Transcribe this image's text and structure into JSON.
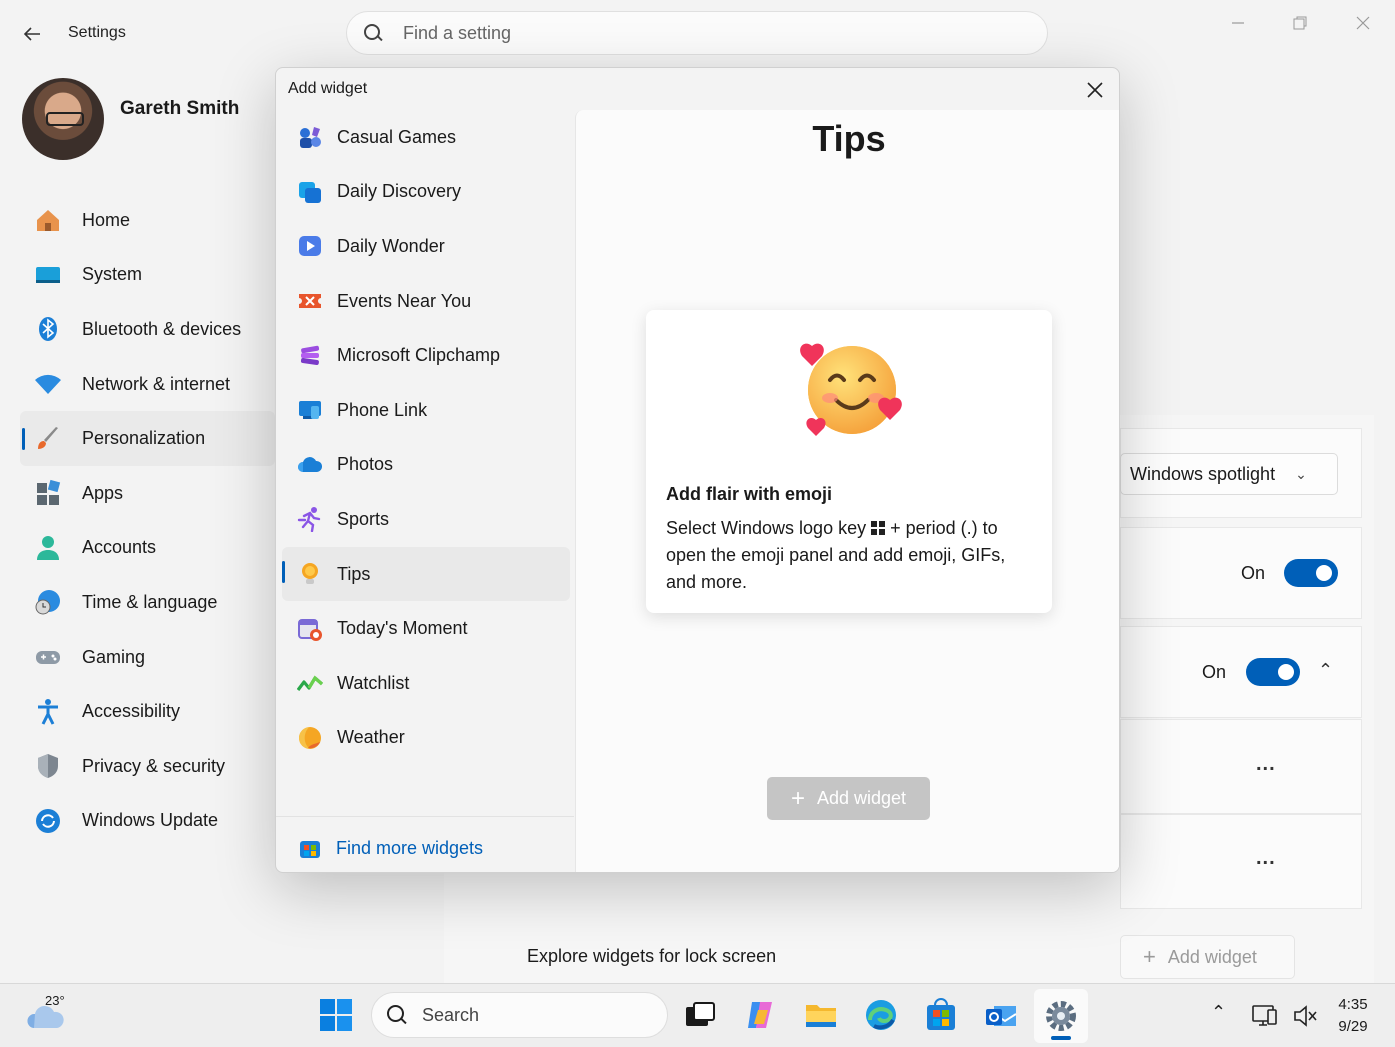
{
  "window": {
    "app_title": "Settings",
    "search_placeholder": "Find a setting"
  },
  "profile": {
    "name": "Gareth Smith"
  },
  "sidebar": {
    "items": [
      {
        "label": "Home",
        "icon": "home-icon"
      },
      {
        "label": "System",
        "icon": "system-icon"
      },
      {
        "label": "Bluetooth & devices",
        "icon": "bluetooth-icon"
      },
      {
        "label": "Network & internet",
        "icon": "wifi-icon"
      },
      {
        "label": "Personalization",
        "icon": "paintbrush-icon",
        "active": true
      },
      {
        "label": "Apps",
        "icon": "apps-icon"
      },
      {
        "label": "Accounts",
        "icon": "person-icon"
      },
      {
        "label": "Time & language",
        "icon": "globe-clock-icon"
      },
      {
        "label": "Gaming",
        "icon": "gamepad-icon"
      },
      {
        "label": "Accessibility",
        "icon": "accessibility-icon"
      },
      {
        "label": "Privacy & security",
        "icon": "shield-icon"
      },
      {
        "label": "Windows Update",
        "icon": "update-icon"
      }
    ]
  },
  "background": {
    "dropdown_value": "Windows spotlight",
    "toggle1_label": "On",
    "toggle2_label": "On",
    "more1": "...",
    "more2": "...",
    "explore_label": "Explore widgets for lock screen",
    "add_widget_label": "Add widget"
  },
  "dialog": {
    "title": "Add widget",
    "widgets": [
      {
        "label": "Casual Games",
        "icon": "casual-games-icon"
      },
      {
        "label": "Daily Discovery",
        "icon": "daily-discovery-icon"
      },
      {
        "label": "Daily Wonder",
        "icon": "daily-wonder-icon"
      },
      {
        "label": "Events Near You",
        "icon": "events-icon"
      },
      {
        "label": "Microsoft Clipchamp",
        "icon": "clipchamp-icon"
      },
      {
        "label": "Phone Link",
        "icon": "phone-link-icon"
      },
      {
        "label": "Photos",
        "icon": "photos-icon"
      },
      {
        "label": "Sports",
        "icon": "sports-icon"
      },
      {
        "label": "Tips",
        "icon": "tips-icon",
        "active": true
      },
      {
        "label": "Today's Moment",
        "icon": "todays-moment-icon"
      },
      {
        "label": "Watchlist",
        "icon": "watchlist-icon"
      },
      {
        "label": "Weather",
        "icon": "weather-icon"
      }
    ],
    "find_more": "Find more widgets",
    "preview": {
      "title": "Tips",
      "card_heading": "Add flair with emoji",
      "card_body_before": "Select Windows logo key ",
      "card_body_after": " + period (.) to open the emoji panel and add emoji, GIFs, and more.",
      "add_button": "Add widget"
    }
  },
  "taskbar": {
    "weather_temp": "23°",
    "search_label": "Search",
    "time": "4:35",
    "date": "9/29"
  },
  "colors": {
    "accent": "#005fb8"
  }
}
